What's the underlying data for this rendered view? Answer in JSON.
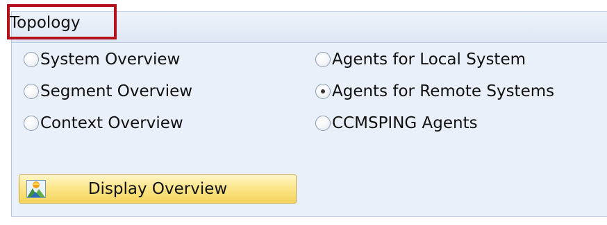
{
  "group": {
    "title": "Topology"
  },
  "radio_options": [
    {
      "label": "System Overview",
      "checked": false
    },
    {
      "label": "Segment Overview",
      "checked": false
    },
    {
      "label": "Context Overview",
      "checked": false
    },
    {
      "label": "Agents for Local System",
      "checked": false
    },
    {
      "label": "Agents for Remote Systems",
      "checked": true
    },
    {
      "label": "CCMSPING Agents",
      "checked": false
    }
  ],
  "button": {
    "label": "Display Overview",
    "icon": "landscape-overview-icon"
  },
  "colors": {
    "group_background": "#e9f0f9",
    "highlight_border": "#b3121d",
    "button_background": "#fbe68a"
  }
}
